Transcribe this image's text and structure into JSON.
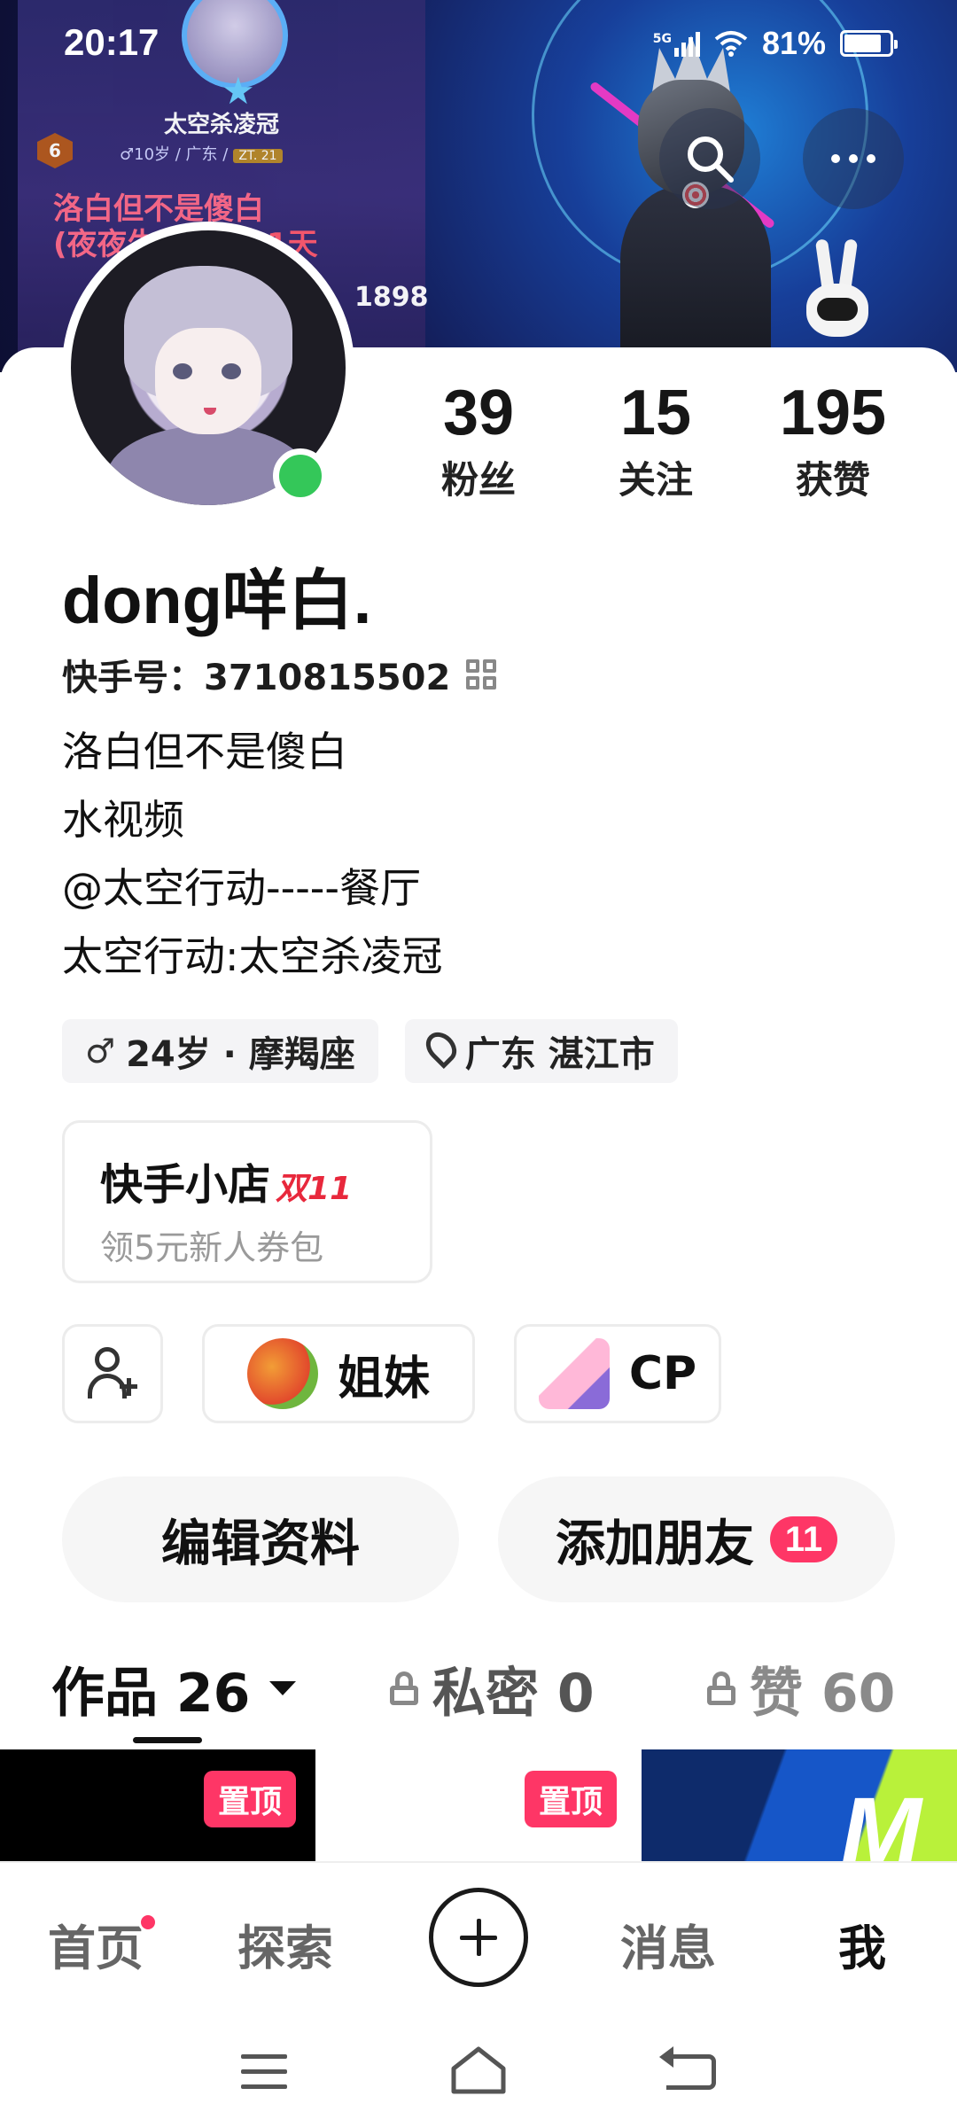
{
  "status_bar": {
    "time": "20:17",
    "network": "5G",
    "battery": "81%",
    "battery_level": 0.81
  },
  "banner": {
    "card_name": "太空杀凌冠",
    "card_rank": "6",
    "card_meta": "♂10岁 / 广东 /",
    "card_tag": "ZT. 21",
    "card_line1": "洛白但不是傻白",
    "card_line2_prefix": "(夜夜生",
    "card_line2_suffix": "时: 1天",
    "card_number": "1898",
    "icons": {
      "search": "search-icon",
      "more": "more-dots-icon"
    }
  },
  "profile": {
    "stats": [
      {
        "value": "39",
        "label": "粉丝"
      },
      {
        "value": "15",
        "label": "关注"
      },
      {
        "value": "195",
        "label": "获赞"
      }
    ],
    "nickname": "dong咩白.",
    "kuaishou_id_label": "快手号：",
    "kuaishou_id": "3710815502",
    "bio": [
      "洛白但不是傻白",
      "水视频",
      "@太空行动-----餐厅",
      "太空行动:太空杀凌冠"
    ],
    "chips": {
      "age_zodiac": "24岁 · 摩羯座",
      "location": "广东 湛江市"
    },
    "shop": {
      "title": "快手小店",
      "badge": "双11",
      "subtitle": "领5元新人券包"
    },
    "relations": {
      "sisters": "姐妹",
      "cp": "CP"
    },
    "buttons": {
      "edit": "编辑资料",
      "add_friends": "添加朋友",
      "add_friends_count": "11"
    }
  },
  "tabs": {
    "works": "作品 26",
    "private": "私密 0",
    "likes": "赞 60"
  },
  "thumbs": {
    "pin_label": "置顶",
    "third_letter": "M"
  },
  "bottom_nav": {
    "home": "首页",
    "explore": "探索",
    "messages": "消息",
    "me": "我"
  }
}
